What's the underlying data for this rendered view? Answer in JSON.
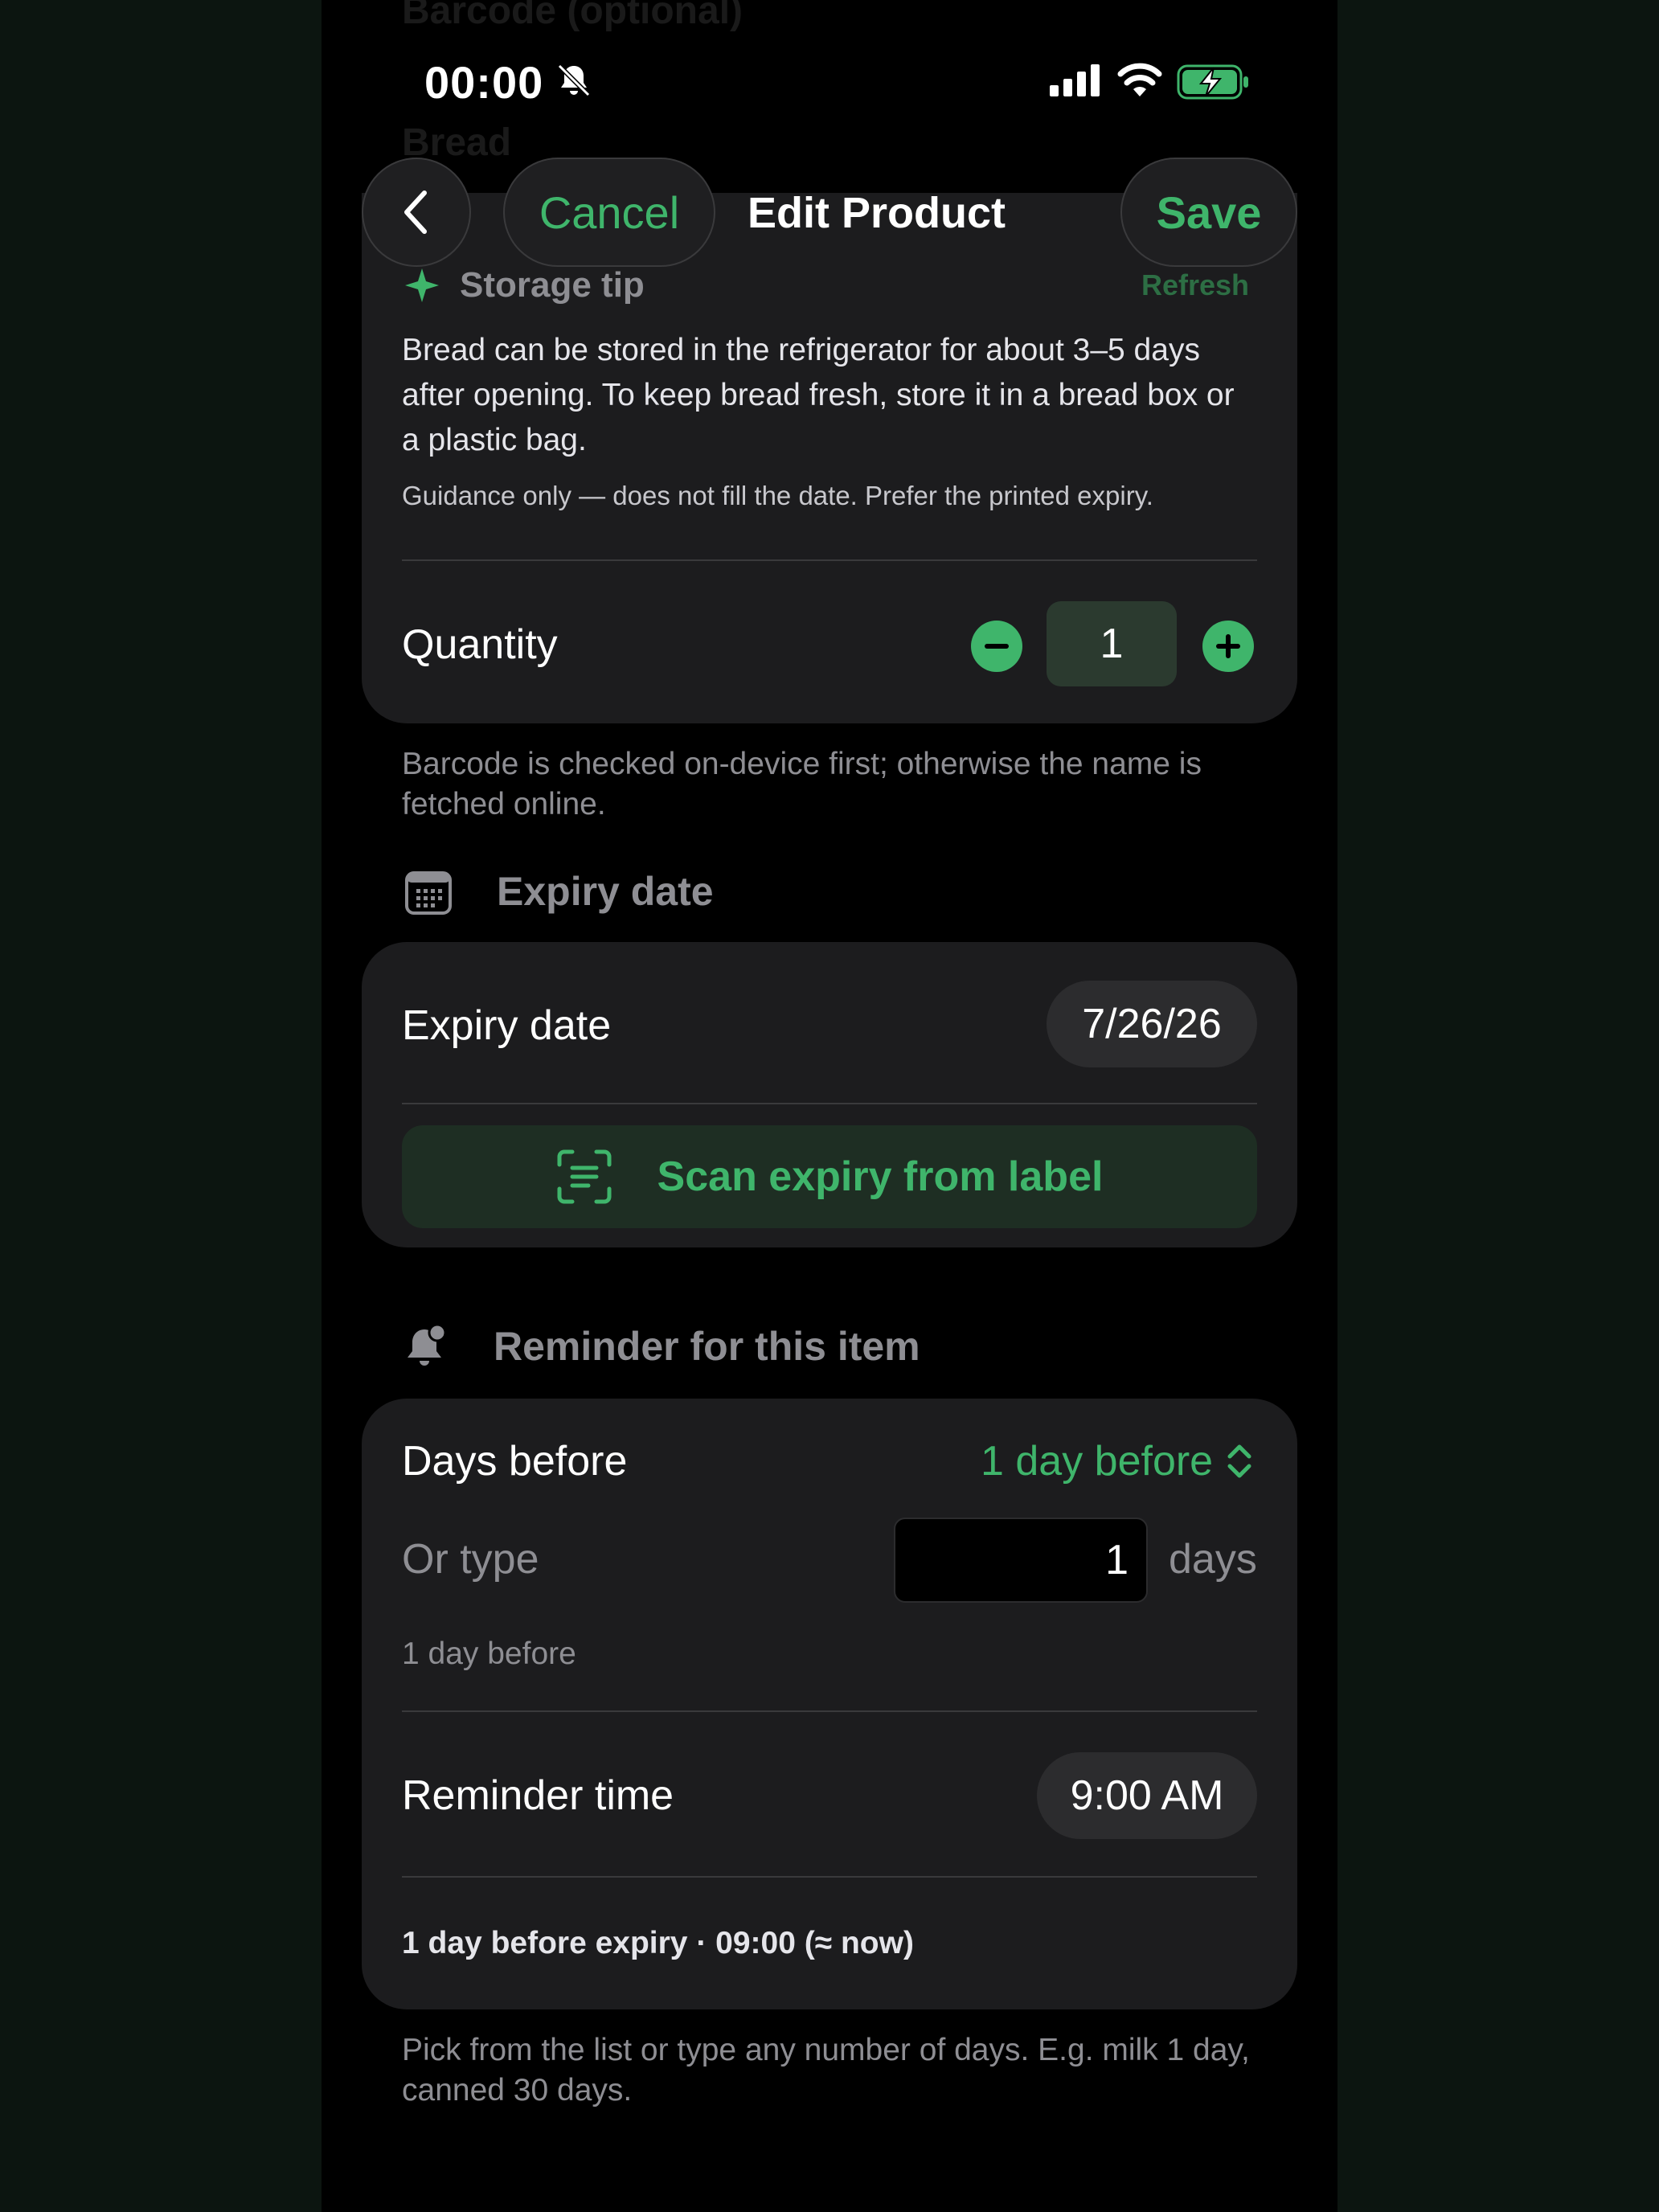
{
  "background_faded": {
    "line1": "Barcode (optional)",
    "line2": "Bread"
  },
  "status_bar": {
    "time": "00:00"
  },
  "nav": {
    "cancel_label": "Cancel",
    "title": "Edit Product",
    "save_label": "Save"
  },
  "storage_tip": {
    "heading": "Storage tip",
    "refresh_label": "Refresh",
    "text": "Bread can be stored in the refrigerator for about 3–5 days after opening. To keep bread fresh, store it in a bread box or a plastic bag.",
    "note": "Guidance only — does not fill the date. Prefer the printed expiry."
  },
  "quantity": {
    "label": "Quantity",
    "value": "1"
  },
  "barcode_footnote": "Barcode is checked on-device first; otherwise the name is fetched online.",
  "expiry_section": {
    "heading": "Expiry date",
    "row_label": "Expiry date",
    "date_value": "7/26/26",
    "scan_label": "Scan expiry from label"
  },
  "reminder_section": {
    "heading": "Reminder for this item",
    "days_before_label": "Days before",
    "days_before_value": "1 day before",
    "or_type_label": "Or type",
    "typed_days": "1",
    "days_suffix": "days",
    "helper_text": "1 day before",
    "time_label": "Reminder time",
    "time_value": "9:00 AM",
    "summary": "1 day before expiry · 09:00 (≈ now)",
    "footnote": "Pick from the list or type any number of days. E.g. milk 1 day, canned 30 days."
  },
  "colors": {
    "accent": "#3fb56b",
    "card": "#1c1c1e",
    "background": "#000000"
  }
}
